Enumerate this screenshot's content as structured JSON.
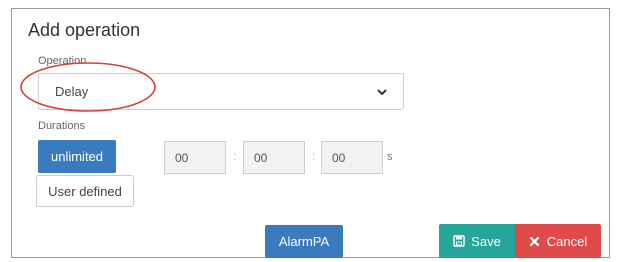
{
  "dialog": {
    "title": "Add operation",
    "operation_label": "Operation",
    "operation_value": "Delay",
    "durations_label": "Durations",
    "unlimited_label": "unlimited",
    "user_defined_label": "User defined",
    "time": {
      "hours": "00",
      "minutes": "00",
      "seconds": "00",
      "separator": ":",
      "unit": "s"
    },
    "alarm_label": "AlarmPA",
    "save_label": "Save",
    "cancel_label": "Cancel"
  },
  "icons": {
    "select": "chevron-down-icon",
    "save": "floppy-disk-icon",
    "cancel": "close-icon"
  },
  "colors": {
    "primary": "#3a7abf",
    "save": "#26a69a",
    "cancel": "#e04a4a",
    "highlight": "#d93c3c"
  }
}
